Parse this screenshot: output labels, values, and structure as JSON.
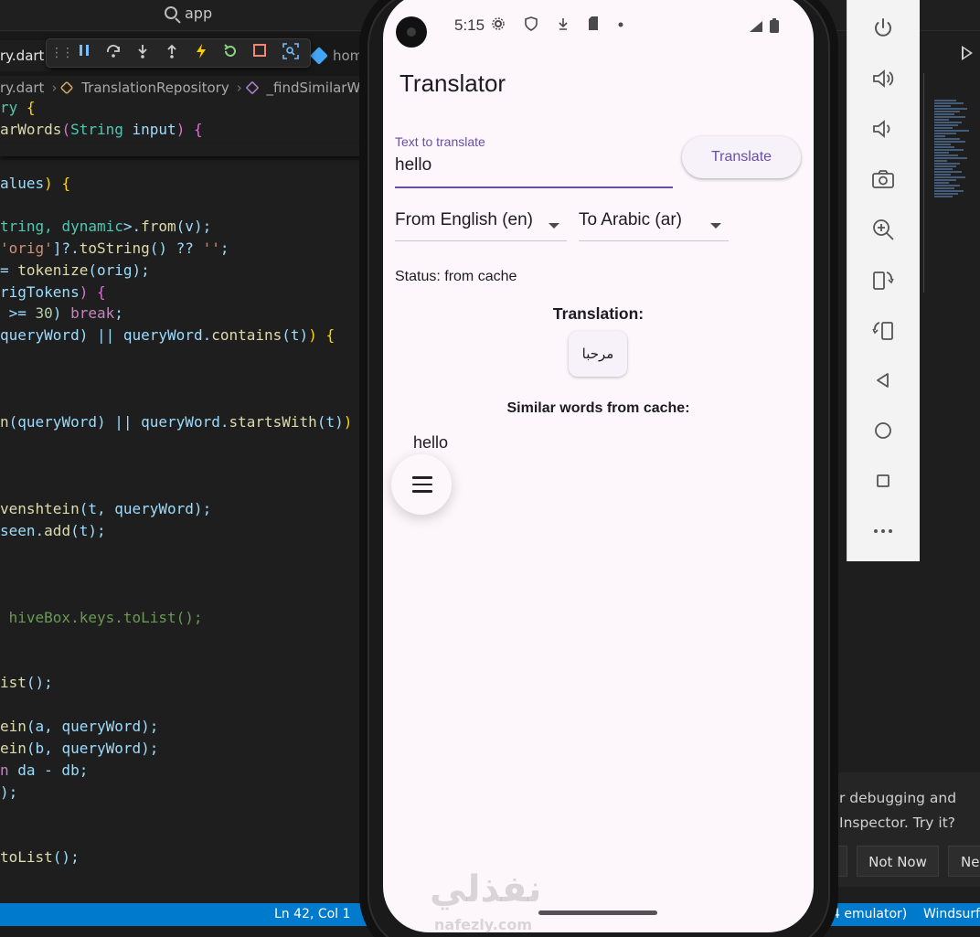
{
  "vscode": {
    "search_text": "app",
    "active_tab": "ry.dart",
    "second_tab": "hom",
    "breadcrumb": {
      "file": "ry.dart",
      "class": "TranslationRepository",
      "method": "_findSimilarWo"
    },
    "code_lines": [
      {
        "t": 120,
        "parts": [
          [
            "ry ",
            "ty"
          ],
          [
            "{",
            "br"
          ]
        ]
      },
      {
        "t": 144,
        "parts": [
          [
            "arWords",
            "fn"
          ],
          [
            "(",
            "br2"
          ],
          [
            "String ",
            "ty"
          ],
          [
            "input",
            "vr"
          ],
          [
            ") ",
            "br2"
          ],
          [
            "{",
            "br2"
          ]
        ]
      },
      {
        "t": 203,
        "parts": [
          [
            "alues",
            "vr"
          ],
          [
            ") {",
            "br"
          ]
        ]
      },
      {
        "t": 250,
        "parts": [
          [
            "tring, ",
            "ty"
          ],
          [
            "dynamic",
            "ty"
          ],
          [
            ">.",
            "vr"
          ],
          [
            "from",
            "fn"
          ],
          [
            "(v);",
            "vr"
          ]
        ]
      },
      {
        "t": 274,
        "parts": [
          [
            "'orig'",
            "st"
          ],
          [
            "]?.",
            "vr"
          ],
          [
            "toString",
            "fn"
          ],
          [
            "() ?? ",
            "vr"
          ],
          [
            "''",
            "st"
          ],
          [
            ";",
            "vr"
          ]
        ]
      },
      {
        "t": 298,
        "parts": [
          [
            "= ",
            "vr"
          ],
          [
            "tokenize",
            "fn"
          ],
          [
            "(orig);",
            "vr"
          ]
        ]
      },
      {
        "t": 322,
        "parts": [
          [
            "rigTokens",
            "vr"
          ],
          [
            ") {",
            "br2"
          ]
        ]
      },
      {
        "t": 345,
        "parts": [
          [
            " >= ",
            "vr"
          ],
          [
            "30",
            "nm"
          ],
          [
            ") ",
            "vr"
          ],
          [
            "break",
            "kw"
          ],
          [
            ";",
            "vr"
          ]
        ]
      },
      {
        "t": 369,
        "parts": [
          [
            "queryWord",
            "vr"
          ],
          [
            ") || ",
            "vr"
          ],
          [
            "queryWord",
            "vr"
          ],
          [
            ".",
            "vr"
          ],
          [
            "contains",
            "fn"
          ],
          [
            "(t)",
            "vr"
          ],
          [
            ") {",
            "br"
          ]
        ]
      },
      {
        "t": 464,
        "parts": [
          [
            "n",
            "fn"
          ],
          [
            "(queryWord",
            "vr"
          ],
          [
            ") || ",
            "vr"
          ],
          [
            "queryWord",
            "vr"
          ],
          [
            ".",
            "vr"
          ],
          [
            "startsWith",
            "fn"
          ],
          [
            "(t)",
            "vr"
          ],
          [
            ") ",
            "br"
          ]
        ]
      },
      {
        "t": 559,
        "parts": [
          [
            "venshtein",
            "fn"
          ],
          [
            "(t, queryWord);",
            "vr"
          ]
        ]
      },
      {
        "t": 583,
        "parts": [
          [
            "seen",
            "vr"
          ],
          [
            ".",
            "vr"
          ],
          [
            "add",
            "fn"
          ],
          [
            "(t);",
            "vr"
          ]
        ]
      },
      {
        "t": 678,
        "parts": [
          [
            " hiveBox.keys.toList();",
            "cm"
          ]
        ]
      },
      {
        "t": 749,
        "parts": [
          [
            "ist",
            "fn"
          ],
          [
            "();",
            "vr"
          ]
        ]
      },
      {
        "t": 797,
        "parts": [
          [
            "ein",
            "fn"
          ],
          [
            "(a, queryWord);",
            "vr"
          ]
        ]
      },
      {
        "t": 821,
        "parts": [
          [
            "ein",
            "fn"
          ],
          [
            "(b, queryWord);",
            "vr"
          ]
        ]
      },
      {
        "t": 845,
        "parts": [
          [
            "n ",
            "kw"
          ],
          [
            "da - db;",
            "vr"
          ]
        ]
      },
      {
        "t": 869,
        "parts": [
          [
            ");",
            "vr"
          ]
        ]
      },
      {
        "t": 940,
        "parts": [
          [
            "toList",
            "fn"
          ],
          [
            "();",
            "vr"
          ]
        ]
      }
    ],
    "status": {
      "position": "Ln 42, Col 1",
      "emulator": "4 emulator)",
      "right": "Windsurf"
    },
    "notification": {
      "line1": "r debugging and",
      "line2": "Inspector. Try it?",
      "btn_not_now": "Not Now",
      "btn_next": "Nev"
    }
  },
  "emulator_toolbar": {
    "buttons": [
      "power-icon",
      "volume-up-icon",
      "volume-down-icon",
      "camera-icon",
      "zoom-in-icon",
      "rotate-right-icon",
      "rotate-left-icon",
      "back-icon",
      "home-icon",
      "overview-icon",
      "more-icon"
    ]
  },
  "phone": {
    "time": "5:15",
    "app": {
      "title": "Translator",
      "input_label": "Text to translate",
      "input_value": "hello",
      "translate_button": "Translate",
      "from_lang": "From English (en)",
      "to_lang": "To Arabic (ar)",
      "status": "Status: from cache",
      "translation_heading": "Translation:",
      "translation_result": "مرحبا",
      "similar_heading": "Similar words from cache:",
      "similar_words": [
        "hello"
      ]
    }
  },
  "watermark": {
    "main": "نفذلي",
    "sub": "nafezly.com"
  },
  "colors": {
    "accent": "#6750a4",
    "screen_bg": "#fdf7fb",
    "status_bar": "#007acc"
  }
}
